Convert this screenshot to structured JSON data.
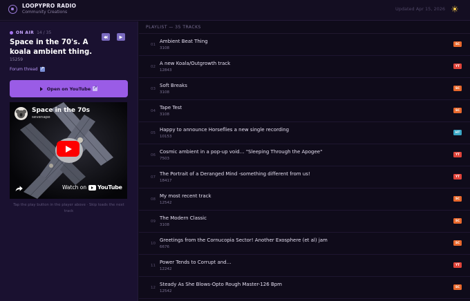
{
  "app": {
    "title": "LOOPYPRO RADIO",
    "subtitle": "Community Creations",
    "updated": "Updated Apr 15, 2026"
  },
  "now_playing": {
    "status": "ON AIR",
    "position": "14 / 35",
    "title": "Space in the 70's. A koala ambient thing.",
    "id": "15259",
    "forum_link": "Forum thread",
    "open_button": "Open on YouTube",
    "hint": "Tap the play button in the player above · Skip loads the next track"
  },
  "player": {
    "video_title": "Space in the 70s",
    "channel": "sevenape",
    "watch_on": "Watch on",
    "brand": "YouTube"
  },
  "playlist": {
    "header": "PLAYLIST — 35 TRACKS",
    "tracks": [
      {
        "num": "01",
        "title": "Ambient Beat Thing",
        "sub": "3108",
        "badge": "SC",
        "color": "#e8682c"
      },
      {
        "num": "02",
        "title": "A new Koala/Outgrowth track",
        "sub": "12843",
        "badge": "YT",
        "color": "#e0443a"
      },
      {
        "num": "03",
        "title": "Soft Breaks",
        "sub": "3108",
        "badge": "SC",
        "color": "#e8682c"
      },
      {
        "num": "04",
        "title": "Tape Test",
        "sub": "3108",
        "badge": "SC",
        "color": "#e8682c"
      },
      {
        "num": "05",
        "title": "Happy to announce Horseflies a new single recording",
        "sub": "10153",
        "badge": "HT",
        "color": "#3aa6c4"
      },
      {
        "num": "06",
        "title": "Cosmic ambient in a pop-up void… \"Sleeping Through the Apogee\"",
        "sub": "7503",
        "badge": "YT",
        "color": "#e0443a"
      },
      {
        "num": "07",
        "title": "The Portrait of a Deranged Mind -something different from us!",
        "sub": "18417",
        "badge": "YT",
        "color": "#e0443a"
      },
      {
        "num": "08",
        "title": "My most recent track",
        "sub": "12542",
        "badge": "SC",
        "color": "#e8682c"
      },
      {
        "num": "09",
        "title": "The Modern Classic",
        "sub": "3108",
        "badge": "SC",
        "color": "#e8682c"
      },
      {
        "num": "10",
        "title": "Greetings from the Cornucopia Sector! Another Exosphere (et al) jam",
        "sub": "6676",
        "badge": "SC",
        "color": "#e8682c"
      },
      {
        "num": "11",
        "title": "Power Tends to Corrupt and…",
        "sub": "12242",
        "badge": "YT",
        "color": "#e0443a"
      },
      {
        "num": "12",
        "title": "Steady As She Blows-Opto Rough Master-126 Bpm",
        "sub": "12542",
        "badge": "SC",
        "color": "#e8682c"
      }
    ]
  }
}
